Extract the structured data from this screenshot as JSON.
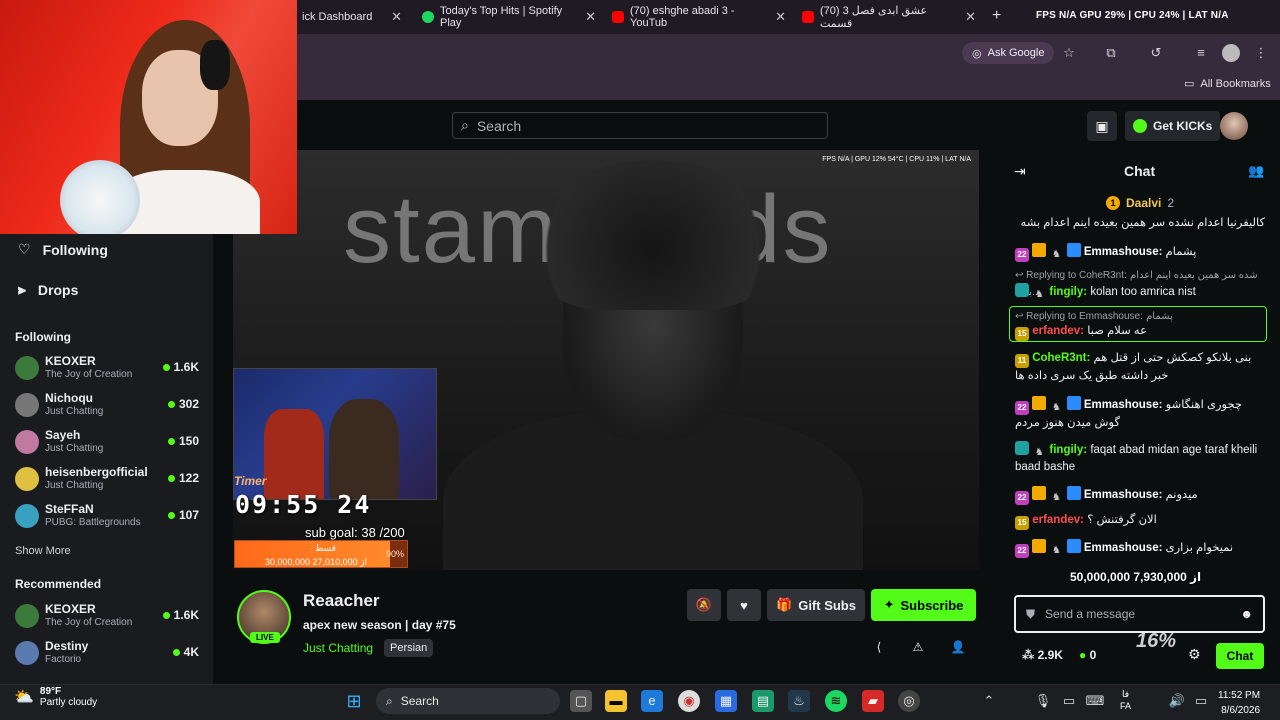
{
  "browser": {
    "tabs": [
      {
        "label": "ick Dashboard",
        "color": "#53fc18"
      },
      {
        "label": "Today's Top Hits | Spotify Play",
        "color": "#1ed760"
      },
      {
        "label": "(70) eshghe abadi 3 - YouTub",
        "color": "#ff0000"
      },
      {
        "label": "(70) عشق ابدی فصل 3 قسمت",
        "color": "#ff0000"
      }
    ],
    "perf_readout": "FPS N/A GPU 29% | CPU 24% | LAT N/A",
    "ask_google": "Ask Google",
    "all_bookmarks": "All Bookmarks"
  },
  "header": {
    "search_placeholder": "Search",
    "get_kicks": "Get KICKs"
  },
  "sidebar": {
    "nav": [
      {
        "label": "Following",
        "icon": "heart-icon"
      },
      {
        "label": "Drops",
        "icon": "drops-icon"
      }
    ],
    "following_heading": "Following",
    "following": [
      {
        "name": "KEOXER",
        "category": "The Joy of Creation",
        "viewers": "1.6K",
        "color": "#3a7a3a"
      },
      {
        "name": "Nichoqu",
        "category": "Just Chatting",
        "viewers": "302",
        "color": "#777777"
      },
      {
        "name": "Sayeh",
        "category": "Just Chatting",
        "viewers": "150",
        "color": "#c07aa0"
      },
      {
        "name": "heisenbergofficial",
        "category": "Just Chatting",
        "viewers": "122",
        "color": "#e0c040"
      },
      {
        "name": "SteFFaN",
        "category": "PUBG: Battlegrounds",
        "viewers": "107",
        "color": "#3aa0c0"
      }
    ],
    "show_more": "Show More",
    "recommended_heading": "Recommended",
    "recommended": [
      {
        "name": "KEOXER",
        "category": "The Joy of Creation",
        "viewers": "1.6K",
        "color": "#3a7a3a"
      },
      {
        "name": "Destiny",
        "category": "Factorio",
        "viewers": "4K",
        "color": "#5a7ab0"
      }
    ]
  },
  "video": {
    "perf_readout": "FPS N/A | GPU 12% 54°C | CPU 11% | LAT N/A",
    "bg_text": "stamy ards",
    "timer_label": "Timer",
    "timer": "09:55 24",
    "sub_goal": "sub goal: 38 /200",
    "goal_title": "قسط",
    "goal_amount": "30,000,000 از 27,010,000",
    "goal_percent": "90%",
    "goal_progress": 0.9
  },
  "channel": {
    "name": "Reaacher",
    "live_badge": "LIVE",
    "title": "apex new season | day #75",
    "category": "Just Chatting",
    "tag": "Persian",
    "gift_subs": "Gift Subs",
    "subscribe": "Subscribe"
  },
  "chat": {
    "title": "Chat",
    "pinned_user": "Daalvi",
    "pinned_count": "2",
    "messages": [
      {
        "text": "کالیفرنیا اعدام نشده سر همین بعیده اینم اعدام بشه"
      },
      {
        "user": "Emmashouse:",
        "user_color": "#ffffff",
        "text": "پشمام",
        "sub": "22",
        "sub_color": "#c040c0"
      },
      {
        "reply": "Replying to CoheR3nt:",
        "reply_text": "شده سر همین بعیده اینم اعدام بشه..."
      },
      {
        "user": "fingily:",
        "user_color": "#53fc18",
        "text": "kolan too amrica nist",
        "sub": "",
        "sub_color": "#20a0a0"
      },
      {
        "reply": "Replying to Emmashouse:",
        "reply_text": "پشمام"
      },
      {
        "user": "erfandev:",
        "user_color": "#ff4d4d",
        "text": "عه سلام صبا",
        "sub": "15",
        "sub_color": "#c8a000"
      },
      {
        "user": "CoheR3nt:",
        "user_color": "#53fc18",
        "text": "بنی بلانکو کصکش حتی از قتل هم خبر داشته طبق یک سری داده ها",
        "sub": "11",
        "sub_color": "#c8a000"
      },
      {
        "user": "Emmashouse:",
        "user_color": "#ffffff",
        "text": "چجوری اهنگاشو گوش میدن هنوز مردم",
        "sub": "22",
        "sub_color": "#c040c0"
      },
      {
        "user": "fingily:",
        "user_color": "#53fc18",
        "text": "faqat abad midan age taraf kheili baad bashe",
        "sub": "",
        "sub_color": "#20a0a0"
      },
      {
        "user": "Emmashouse:",
        "user_color": "#ffffff",
        "text": "میدونم",
        "sub": "22",
        "sub_color": "#c040c0"
      },
      {
        "user": "erfandev:",
        "user_color": "#ff4d4d",
        "text": "الان گرفتنش ؟",
        "sub": "15",
        "sub_color": "#c8a000"
      },
      {
        "user": "Emmashouse:",
        "user_color": "#ffffff",
        "text": "نمیخوام بزاری",
        "sub": "22",
        "sub_color": "#c040c0"
      }
    ],
    "donation_overlay": "50,000,000 از 7,930,000",
    "percent_overlay": "16%",
    "input_placeholder": "Send a message",
    "kicks_count": "2.9K",
    "coins_count": "0",
    "send_label": "Chat"
  },
  "taskbar": {
    "weather_temp": "89°F",
    "weather_desc": "Partly cloudy",
    "search_label": "Search",
    "lang_top": "فا",
    "lang_bottom": "FA",
    "time": "11:52 PM",
    "date": "8/6/2026"
  }
}
